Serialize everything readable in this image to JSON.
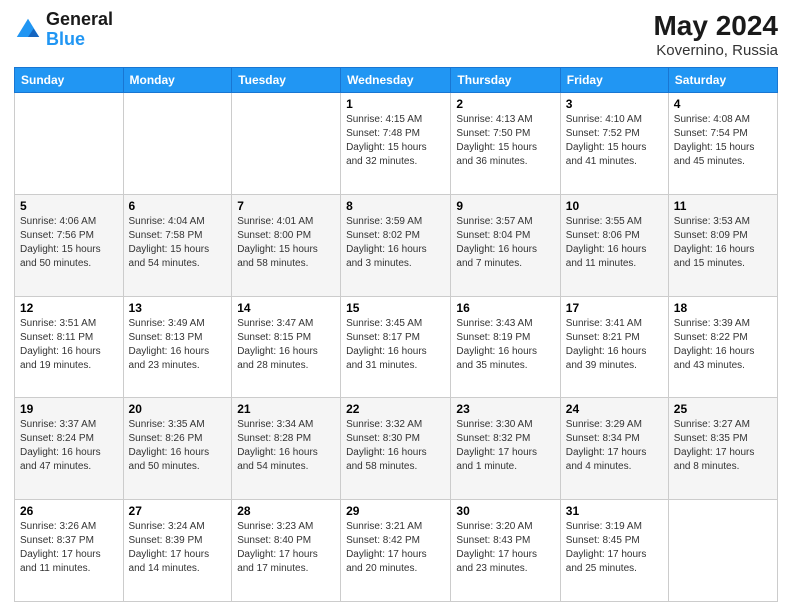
{
  "logo": {
    "line1": "General",
    "line2": "Blue"
  },
  "title": {
    "month_year": "May 2024",
    "location": "Kovernino, Russia"
  },
  "weekdays": [
    "Sunday",
    "Monday",
    "Tuesday",
    "Wednesday",
    "Thursday",
    "Friday",
    "Saturday"
  ],
  "weeks": [
    [
      {
        "day": "",
        "sunrise": "",
        "sunset": "",
        "daylight": ""
      },
      {
        "day": "",
        "sunrise": "",
        "sunset": "",
        "daylight": ""
      },
      {
        "day": "",
        "sunrise": "",
        "sunset": "",
        "daylight": ""
      },
      {
        "day": "1",
        "sunrise": "Sunrise: 4:15 AM",
        "sunset": "Sunset: 7:48 PM",
        "daylight": "Daylight: 15 hours and 32 minutes."
      },
      {
        "day": "2",
        "sunrise": "Sunrise: 4:13 AM",
        "sunset": "Sunset: 7:50 PM",
        "daylight": "Daylight: 15 hours and 36 minutes."
      },
      {
        "day": "3",
        "sunrise": "Sunrise: 4:10 AM",
        "sunset": "Sunset: 7:52 PM",
        "daylight": "Daylight: 15 hours and 41 minutes."
      },
      {
        "day": "4",
        "sunrise": "Sunrise: 4:08 AM",
        "sunset": "Sunset: 7:54 PM",
        "daylight": "Daylight: 15 hours and 45 minutes."
      }
    ],
    [
      {
        "day": "5",
        "sunrise": "Sunrise: 4:06 AM",
        "sunset": "Sunset: 7:56 PM",
        "daylight": "Daylight: 15 hours and 50 minutes."
      },
      {
        "day": "6",
        "sunrise": "Sunrise: 4:04 AM",
        "sunset": "Sunset: 7:58 PM",
        "daylight": "Daylight: 15 hours and 54 minutes."
      },
      {
        "day": "7",
        "sunrise": "Sunrise: 4:01 AM",
        "sunset": "Sunset: 8:00 PM",
        "daylight": "Daylight: 15 hours and 58 minutes."
      },
      {
        "day": "8",
        "sunrise": "Sunrise: 3:59 AM",
        "sunset": "Sunset: 8:02 PM",
        "daylight": "Daylight: 16 hours and 3 minutes."
      },
      {
        "day": "9",
        "sunrise": "Sunrise: 3:57 AM",
        "sunset": "Sunset: 8:04 PM",
        "daylight": "Daylight: 16 hours and 7 minutes."
      },
      {
        "day": "10",
        "sunrise": "Sunrise: 3:55 AM",
        "sunset": "Sunset: 8:06 PM",
        "daylight": "Daylight: 16 hours and 11 minutes."
      },
      {
        "day": "11",
        "sunrise": "Sunrise: 3:53 AM",
        "sunset": "Sunset: 8:09 PM",
        "daylight": "Daylight: 16 hours and 15 minutes."
      }
    ],
    [
      {
        "day": "12",
        "sunrise": "Sunrise: 3:51 AM",
        "sunset": "Sunset: 8:11 PM",
        "daylight": "Daylight: 16 hours and 19 minutes."
      },
      {
        "day": "13",
        "sunrise": "Sunrise: 3:49 AM",
        "sunset": "Sunset: 8:13 PM",
        "daylight": "Daylight: 16 hours and 23 minutes."
      },
      {
        "day": "14",
        "sunrise": "Sunrise: 3:47 AM",
        "sunset": "Sunset: 8:15 PM",
        "daylight": "Daylight: 16 hours and 28 minutes."
      },
      {
        "day": "15",
        "sunrise": "Sunrise: 3:45 AM",
        "sunset": "Sunset: 8:17 PM",
        "daylight": "Daylight: 16 hours and 31 minutes."
      },
      {
        "day": "16",
        "sunrise": "Sunrise: 3:43 AM",
        "sunset": "Sunset: 8:19 PM",
        "daylight": "Daylight: 16 hours and 35 minutes."
      },
      {
        "day": "17",
        "sunrise": "Sunrise: 3:41 AM",
        "sunset": "Sunset: 8:21 PM",
        "daylight": "Daylight: 16 hours and 39 minutes."
      },
      {
        "day": "18",
        "sunrise": "Sunrise: 3:39 AM",
        "sunset": "Sunset: 8:22 PM",
        "daylight": "Daylight: 16 hours and 43 minutes."
      }
    ],
    [
      {
        "day": "19",
        "sunrise": "Sunrise: 3:37 AM",
        "sunset": "Sunset: 8:24 PM",
        "daylight": "Daylight: 16 hours and 47 minutes."
      },
      {
        "day": "20",
        "sunrise": "Sunrise: 3:35 AM",
        "sunset": "Sunset: 8:26 PM",
        "daylight": "Daylight: 16 hours and 50 minutes."
      },
      {
        "day": "21",
        "sunrise": "Sunrise: 3:34 AM",
        "sunset": "Sunset: 8:28 PM",
        "daylight": "Daylight: 16 hours and 54 minutes."
      },
      {
        "day": "22",
        "sunrise": "Sunrise: 3:32 AM",
        "sunset": "Sunset: 8:30 PM",
        "daylight": "Daylight: 16 hours and 58 minutes."
      },
      {
        "day": "23",
        "sunrise": "Sunrise: 3:30 AM",
        "sunset": "Sunset: 8:32 PM",
        "daylight": "Daylight: 17 hours and 1 minute."
      },
      {
        "day": "24",
        "sunrise": "Sunrise: 3:29 AM",
        "sunset": "Sunset: 8:34 PM",
        "daylight": "Daylight: 17 hours and 4 minutes."
      },
      {
        "day": "25",
        "sunrise": "Sunrise: 3:27 AM",
        "sunset": "Sunset: 8:35 PM",
        "daylight": "Daylight: 17 hours and 8 minutes."
      }
    ],
    [
      {
        "day": "26",
        "sunrise": "Sunrise: 3:26 AM",
        "sunset": "Sunset: 8:37 PM",
        "daylight": "Daylight: 17 hours and 11 minutes."
      },
      {
        "day": "27",
        "sunrise": "Sunrise: 3:24 AM",
        "sunset": "Sunset: 8:39 PM",
        "daylight": "Daylight: 17 hours and 14 minutes."
      },
      {
        "day": "28",
        "sunrise": "Sunrise: 3:23 AM",
        "sunset": "Sunset: 8:40 PM",
        "daylight": "Daylight: 17 hours and 17 minutes."
      },
      {
        "day": "29",
        "sunrise": "Sunrise: 3:21 AM",
        "sunset": "Sunset: 8:42 PM",
        "daylight": "Daylight: 17 hours and 20 minutes."
      },
      {
        "day": "30",
        "sunrise": "Sunrise: 3:20 AM",
        "sunset": "Sunset: 8:43 PM",
        "daylight": "Daylight: 17 hours and 23 minutes."
      },
      {
        "day": "31",
        "sunrise": "Sunrise: 3:19 AM",
        "sunset": "Sunset: 8:45 PM",
        "daylight": "Daylight: 17 hours and 25 minutes."
      },
      {
        "day": "",
        "sunrise": "",
        "sunset": "",
        "daylight": ""
      }
    ]
  ]
}
